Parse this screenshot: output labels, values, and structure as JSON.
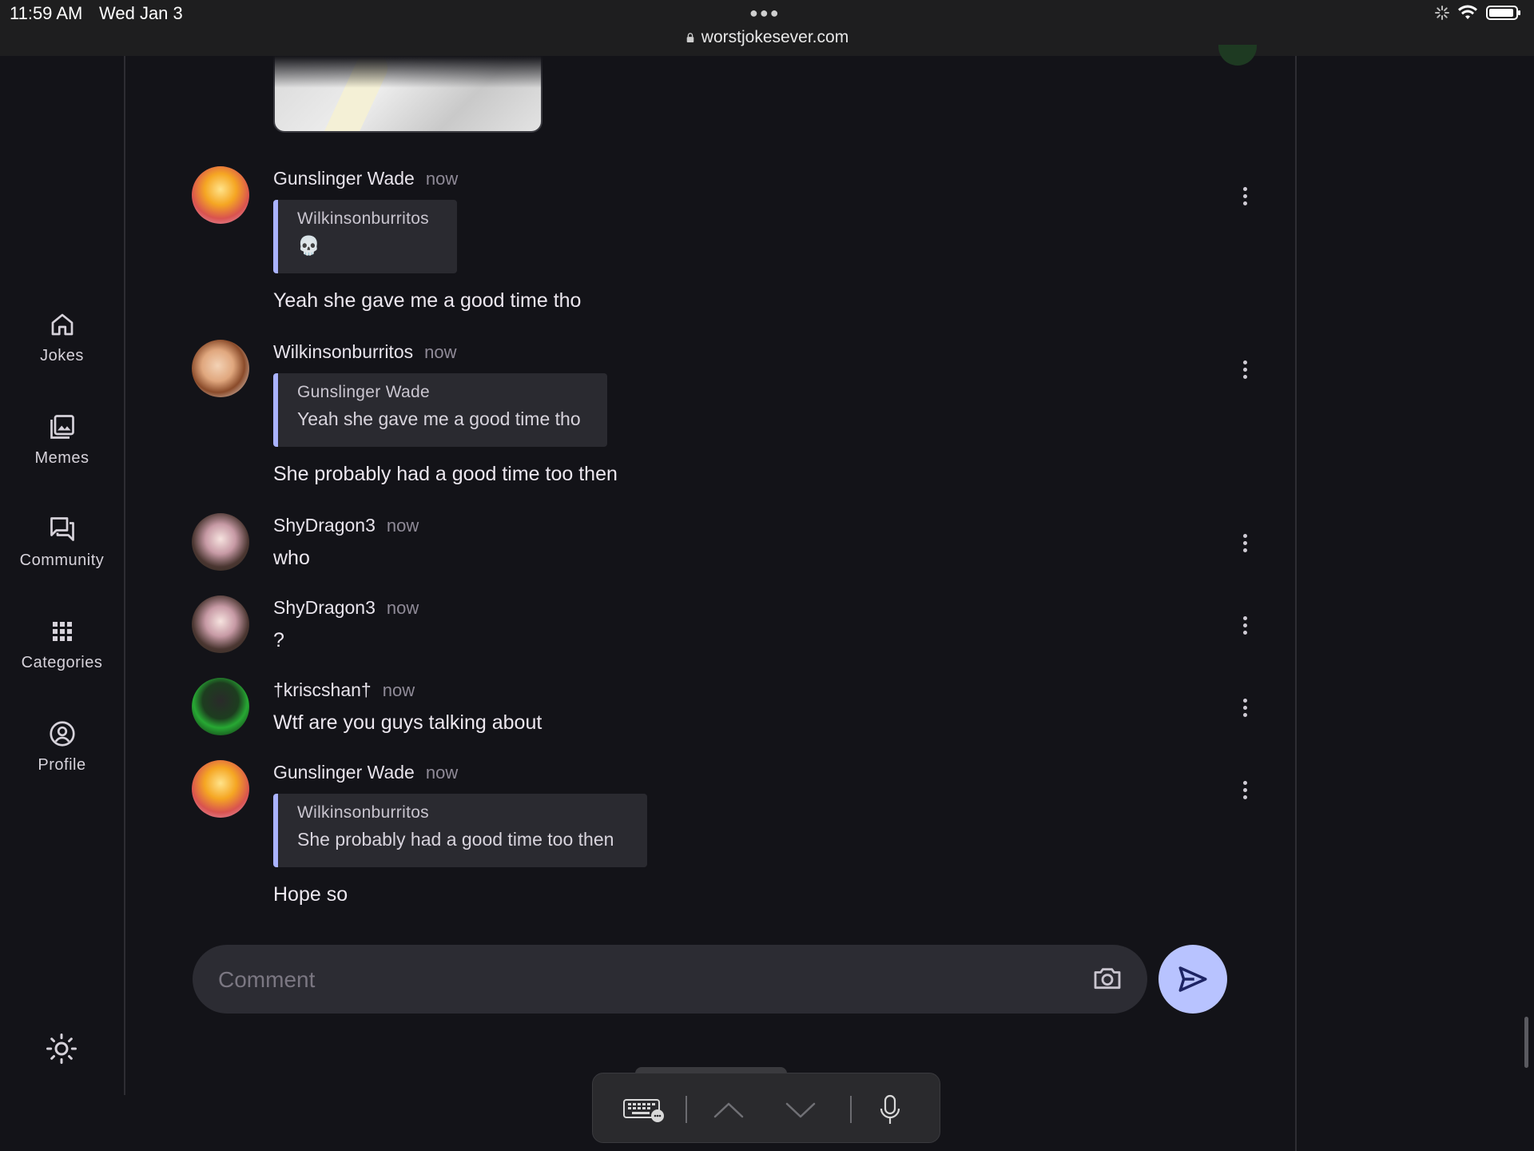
{
  "status_bar": {
    "time": "11:59 AM",
    "date": "Wed Jan 3",
    "url": "worstjokesever.com"
  },
  "sidebar": {
    "items": [
      {
        "label": "Jokes",
        "icon": "home-icon"
      },
      {
        "label": "Memes",
        "icon": "image-gallery-icon"
      },
      {
        "label": "Community",
        "icon": "forum-icon"
      },
      {
        "label": "Categories",
        "icon": "grid-icon"
      },
      {
        "label": "Profile",
        "icon": "account-circle-icon"
      }
    ],
    "theme_toggle_icon": "sun-icon"
  },
  "comments": [
    {
      "author": "Gunslinger Wade",
      "time": "now",
      "avatar": "fire-avatar",
      "quote": {
        "author": "Wilkinsonburritos",
        "text": "💀"
      },
      "text": "Yeah she gave me a good time tho"
    },
    {
      "author": "Wilkinsonburritos",
      "time": "now",
      "avatar": "cartoon-avatar",
      "quote": {
        "author": "Gunslinger Wade",
        "text": "Yeah she gave me a good time tho"
      },
      "text": "She probably had a good time too then"
    },
    {
      "author": "ShyDragon3",
      "time": "now",
      "avatar": "anime-avatar",
      "text": "who"
    },
    {
      "author": "ShyDragon3",
      "time": "now",
      "avatar": "anime-avatar",
      "text": "?"
    },
    {
      "author": "†kriscshan†",
      "time": "now",
      "avatar": "green-avatar",
      "text": "Wtf are you guys talking about"
    },
    {
      "author": "Gunslinger Wade",
      "time": "now",
      "avatar": "fire-avatar",
      "quote": {
        "author": "Wilkinsonburritos",
        "text": "She probably had a good time too then"
      },
      "text": "Hope so"
    }
  ],
  "composer": {
    "placeholder": "Comment",
    "value": "",
    "camera_icon": "camera-icon",
    "send_icon": "send-icon"
  },
  "keyboard_bar": {
    "icons": [
      "keyboard-icon",
      "chevron-up-icon",
      "chevron-down-icon",
      "microphone-icon"
    ]
  },
  "colors": {
    "background": "#131318",
    "accent": "#b8c3ff",
    "quote_bar": "#aab3ff"
  }
}
